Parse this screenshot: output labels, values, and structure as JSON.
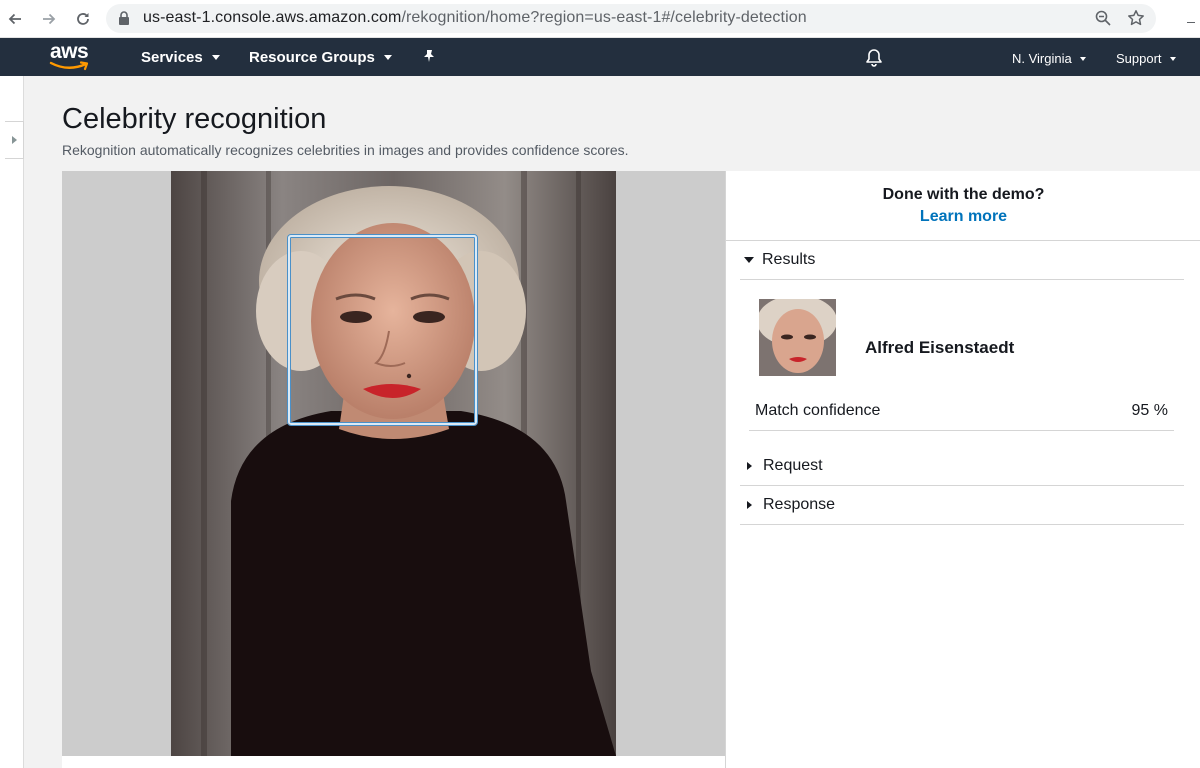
{
  "browser": {
    "url_host": "us-east-1.console.aws.amazon.com",
    "url_path": "/rekognition/home?region=us-east-1#/celebrity-detection"
  },
  "header": {
    "logo_text": "aws",
    "services_label": "Services",
    "resource_groups_label": "Resource Groups",
    "region_label": "N. Virginia",
    "support_label": "Support"
  },
  "page": {
    "title": "Celebrity recognition",
    "subtitle": "Rekognition automatically recognizes celebrities in images and provides confidence scores."
  },
  "results_panel": {
    "demo_question": "Done with the demo?",
    "learn_more_label": "Learn more",
    "results_label": "Results",
    "celebrity_name": "Alfred Eisenstaedt",
    "match_confidence_label": "Match confidence",
    "match_confidence_value": "95 %",
    "request_label": "Request",
    "response_label": "Response"
  },
  "colors": {
    "aws_header": "#232f3e",
    "link_blue": "#0073bb",
    "aws_orange": "#ff9900"
  },
  "icons": [
    "back-arrow-icon",
    "forward-arrow-icon",
    "reload-icon",
    "lock-icon",
    "zoom-icon",
    "bookmark-star-icon",
    "pin-icon",
    "bell-icon"
  ]
}
